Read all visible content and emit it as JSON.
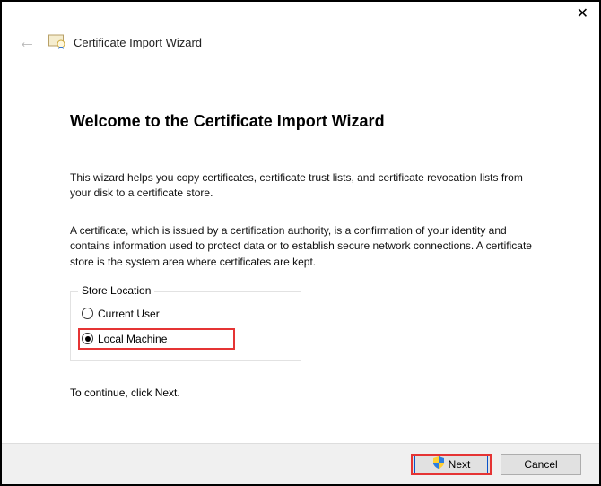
{
  "window": {
    "title": "Certificate Import Wizard"
  },
  "page": {
    "heading": "Welcome to the Certificate Import Wizard",
    "para1": "This wizard helps you copy certificates, certificate trust lists, and certificate revocation lists from your disk to a certificate store.",
    "para2": "A certificate, which is issued by a certification authority, is a confirmation of your identity and contains information used to protect data or to establish secure network connections. A certificate store is the system area where certificates are kept.",
    "continue_hint": "To continue, click Next."
  },
  "store_location": {
    "legend": "Store Location",
    "options": [
      {
        "label": "Current User",
        "selected": false
      },
      {
        "label": "Local Machine",
        "selected": true
      }
    ]
  },
  "footer": {
    "next_label": "Next",
    "cancel_label": "Cancel"
  }
}
